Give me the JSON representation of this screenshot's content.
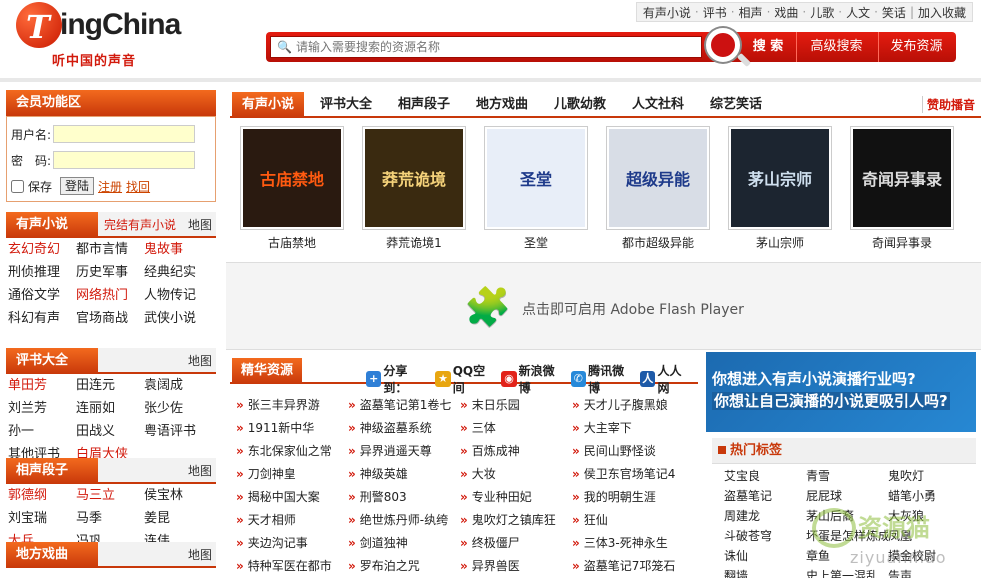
{
  "logo": {
    "brand_mark": "T",
    "brand_text": "ingChina",
    "slogan": "听中国的声音"
  },
  "top_links": [
    "有声小说",
    "评书",
    "相声",
    "戏曲",
    "儿歌",
    "人文",
    "笑话",
    "加入收藏"
  ],
  "search": {
    "placeholder": "请输入需要搜索的资源名称",
    "search_label": "搜 索",
    "advanced_label": "高级搜索",
    "publish_label": "发布资源"
  },
  "member": {
    "title": "会员功能区",
    "username_label": "用户名:",
    "password_label": "密　码:",
    "save_label": "保存",
    "login_label": "登陆",
    "register_label": "注册",
    "retrieve_label": "找回"
  },
  "categories": [
    {
      "tab": "有声小说",
      "extra": "完结有声小说",
      "map": "地图",
      "items": [
        {
          "t": "玄幻奇幻",
          "hot": true
        },
        {
          "t": "都市言情",
          "hot": false
        },
        {
          "t": "鬼故事",
          "hot": true
        },
        {
          "t": "刑侦推理",
          "hot": false
        },
        {
          "t": "历史军事",
          "hot": false
        },
        {
          "t": "经典纪实",
          "hot": false
        },
        {
          "t": "通俗文学",
          "hot": false
        },
        {
          "t": "网络热门",
          "hot": true
        },
        {
          "t": "人物传记",
          "hot": false
        },
        {
          "t": "科幻有声",
          "hot": false
        },
        {
          "t": "官场商战",
          "hot": false
        },
        {
          "t": "武侠小说",
          "hot": false
        }
      ]
    },
    {
      "tab": "评书大全",
      "extra": "",
      "map": "地图",
      "items": [
        {
          "t": "单田芳",
          "hot": true
        },
        {
          "t": "田连元",
          "hot": false
        },
        {
          "t": "袁阔成",
          "hot": false
        },
        {
          "t": "刘兰芳",
          "hot": false
        },
        {
          "t": "连丽如",
          "hot": false
        },
        {
          "t": "张少佐",
          "hot": false
        },
        {
          "t": "孙一",
          "hot": false
        },
        {
          "t": "田战义",
          "hot": false
        },
        {
          "t": "粤语评书",
          "hot": false
        },
        {
          "t": "其他评书",
          "hot": false
        },
        {
          "t": "白眉大侠",
          "hot": true
        },
        {
          "t": "",
          "hot": false
        }
      ]
    },
    {
      "tab": "相声段子",
      "extra": "",
      "map": "地图",
      "items": [
        {
          "t": "郭德纲",
          "hot": true
        },
        {
          "t": "马三立",
          "hot": true
        },
        {
          "t": "侯宝林",
          "hot": false
        },
        {
          "t": "刘宝瑞",
          "hot": false
        },
        {
          "t": "马季",
          "hot": false
        },
        {
          "t": "姜昆",
          "hot": false
        },
        {
          "t": "大兵",
          "hot": true
        },
        {
          "t": "冯巩",
          "hot": false
        },
        {
          "t": "连伟",
          "hot": false
        }
      ]
    },
    {
      "tab": "地方戏曲",
      "extra": "",
      "map": "地图",
      "items": []
    }
  ],
  "tabs": [
    "有声小说",
    "评书大全",
    "相声段子",
    "地方戏曲",
    "儿歌幼教",
    "人文社科",
    "综艺笑话"
  ],
  "sponsor_label": "赞助播音",
  "books": [
    {
      "title": "古庙禁地",
      "cover_text": "古庙禁地",
      "bg": "#2a1a10",
      "fg": "#ff5a10"
    },
    {
      "title": "莽荒诡境1",
      "cover_text": "莽荒诡境",
      "bg": "#3a2a10",
      "fg": "#f5d27a"
    },
    {
      "title": "圣堂",
      "cover_text": "圣堂",
      "bg": "#e8eef8",
      "fg": "#1e3a8a"
    },
    {
      "title": "都市超级异能",
      "cover_text": "超级异能",
      "bg": "#d8dde6",
      "fg": "#1e3a8a"
    },
    {
      "title": "茅山宗师",
      "cover_text": "茅山宗师",
      "bg": "#1c2530",
      "fg": "#cfe0ef"
    },
    {
      "title": "奇闻异事录",
      "cover_text": "奇闻异事录",
      "bg": "#111",
      "fg": "#ddd"
    }
  ],
  "flash": {
    "message": "点击即可启用 Adobe Flash Player"
  },
  "featured": {
    "tab": "精华资源",
    "share_label": "分享到：",
    "share_targets": [
      {
        "label": "QQ空间",
        "color": "#e8a610"
      },
      {
        "label": "新浪微博",
        "color": "#e2231a"
      },
      {
        "label": "腾讯微博",
        "color": "#2789d9"
      },
      {
        "label": "人人网",
        "color": "#1e5aa8"
      }
    ],
    "items": [
      "张三丰异界游",
      "盗墓笔记第1卷七",
      "末日乐园",
      "天才儿子腹黑娘",
      "1911新中华",
      "神级盗墓系统",
      "三体",
      "大主宰下",
      "东北保家仙之常",
      "异界逍遥天尊",
      "百炼成神",
      "民间山野怪谈",
      "刀剑神皇",
      "神级英雄",
      "大妆",
      "侯卫东官场笔记4",
      "揭秘中国大案",
      "刑警803",
      "专业种田妃",
      "我的明朝生涯",
      "天才相师",
      "绝世炼丹师-纨绔",
      "鬼吹灯之镇库狂",
      "狂仙",
      "夹边沟记事",
      "剑道独神",
      "终极僵尸",
      "三体3-死神永生",
      "特种军医在都市",
      "罗布泊之咒",
      "异界兽医",
      "盗墓笔记7邛笼石"
    ]
  },
  "banner": {
    "line1": "你想进入有声小说演播行业吗?",
    "line2": "你想让自己演播的小说更吸引人吗?"
  },
  "hot_tags": {
    "title": "热门标签",
    "items": [
      "艾宝良",
      "青雪",
      "鬼吹灯",
      "盗墓笔记",
      "屁屁球",
      "蜡笔小勇",
      "周建龙",
      "茅山后裔",
      "大灰狼",
      "斗破苍穹",
      "坏蛋是怎样炼成的",
      "凤凰",
      "诛仙",
      "章鱼",
      "摸金校尉",
      "翻墙",
      "史上第一混乱",
      "告声"
    ]
  },
  "watermark": {
    "text1": "资源猫",
    "text2": "ziyuanmao"
  }
}
